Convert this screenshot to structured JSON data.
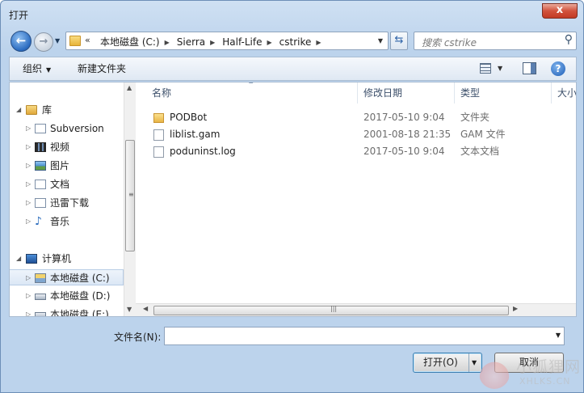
{
  "window": {
    "title": "打开",
    "close_glyph": "x"
  },
  "nav": {
    "back_glyph": "←",
    "forward_glyph": "→"
  },
  "address": {
    "prefix": "«",
    "crumbs": [
      "本地磁盘 (C:)",
      "Sierra",
      "Half-Life",
      "cstrike"
    ]
  },
  "search": {
    "placeholder": "搜索 cstrike"
  },
  "toolbar": {
    "organize": "组织",
    "new_folder": "新建文件夹",
    "help": "?"
  },
  "sidebar": {
    "items": [
      {
        "label": "库",
        "icon": "library-icon"
      },
      {
        "label": "Subversion",
        "icon": "document-library-icon"
      },
      {
        "label": "视频",
        "icon": "video-icon"
      },
      {
        "label": "图片",
        "icon": "picture-icon"
      },
      {
        "label": "文档",
        "icon": "document-icon"
      },
      {
        "label": "迅雷下载",
        "icon": "download-library-icon"
      },
      {
        "label": "音乐",
        "icon": "music-icon"
      },
      {
        "label": "计算机",
        "icon": "computer-icon"
      },
      {
        "label": "本地磁盘 (C:)",
        "icon": "system-drive-icon",
        "selected": true
      },
      {
        "label": "本地磁盘 (D:)",
        "icon": "drive-icon"
      },
      {
        "label": "本地磁盘 (E:)",
        "icon": "drive-icon"
      }
    ]
  },
  "columns": {
    "name": "名称",
    "date": "修改日期",
    "type": "类型",
    "size": "大小"
  },
  "files": [
    {
      "name": "PODBot",
      "date": "2017-05-10 9:04",
      "type": "文件夹",
      "icon": "folder-icon"
    },
    {
      "name": "liblist.gam",
      "date": "2001-08-18 21:35",
      "type": "GAM 文件",
      "icon": "file-icon"
    },
    {
      "name": "poduninst.log",
      "date": "2017-05-10 9:04",
      "type": "文本文档",
      "icon": "text-file-icon"
    }
  ],
  "footer": {
    "filename_label": "文件名(N):",
    "filename_value": "",
    "open_label": "打开(O)",
    "cancel_label": "取消"
  },
  "watermark": {
    "cn": "小狐狸网",
    "en": "XHLKS.CN"
  }
}
